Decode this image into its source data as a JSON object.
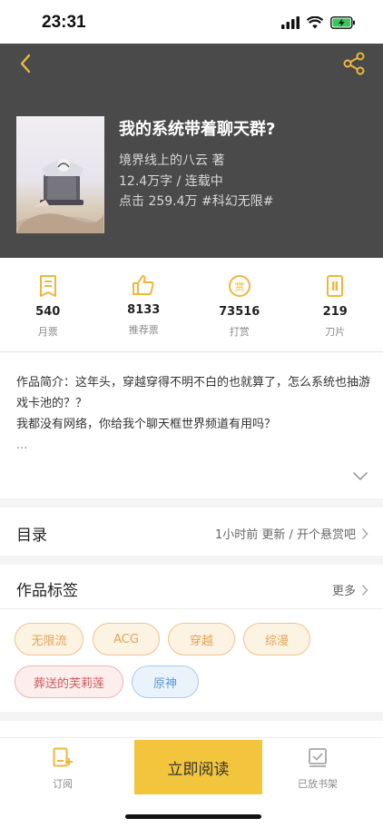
{
  "status": {
    "time": "23:31"
  },
  "book": {
    "title": "我的系统带着聊天群?",
    "author_line": "境界线上的八云 著",
    "meta_line": "12.4万字 / 连载中",
    "clicks_line": "点击 259.4万 #科幻无限#"
  },
  "stats": [
    {
      "icon": "monthly-ticket-icon",
      "value": "540",
      "label": "月票"
    },
    {
      "icon": "thumbs-up-icon",
      "value": "8133",
      "label": "推荐票"
    },
    {
      "icon": "reward-coin-icon",
      "value": "73516",
      "label": "打赏"
    },
    {
      "icon": "blade-card-icon",
      "value": "219",
      "label": "刀片"
    }
  ],
  "intro": {
    "line1": "作品简介：这年头，穿越穿得不明不白的也就算了，怎么系统也抽游戏卡池的？？",
    "line2": "我都没有网络，你给我个聊天框世界频道有用吗？",
    "line3": "..."
  },
  "catalog": {
    "title": "目录",
    "right": "1小时前 更新 / 开个悬赏吧"
  },
  "tags_section": {
    "title": "作品标签",
    "more": "更多"
  },
  "tags": [
    "无限流",
    "ACG",
    "穿越",
    "综漫",
    "葬送的芙莉莲",
    "原神"
  ],
  "bottom": {
    "subscribe": "订阅",
    "read": "立即阅读",
    "shelf": "已放书架"
  },
  "colors": {
    "header_bg": "#4a4a4a",
    "accent": "#f2c53d",
    "icon_yellow": "#f0b63a"
  }
}
